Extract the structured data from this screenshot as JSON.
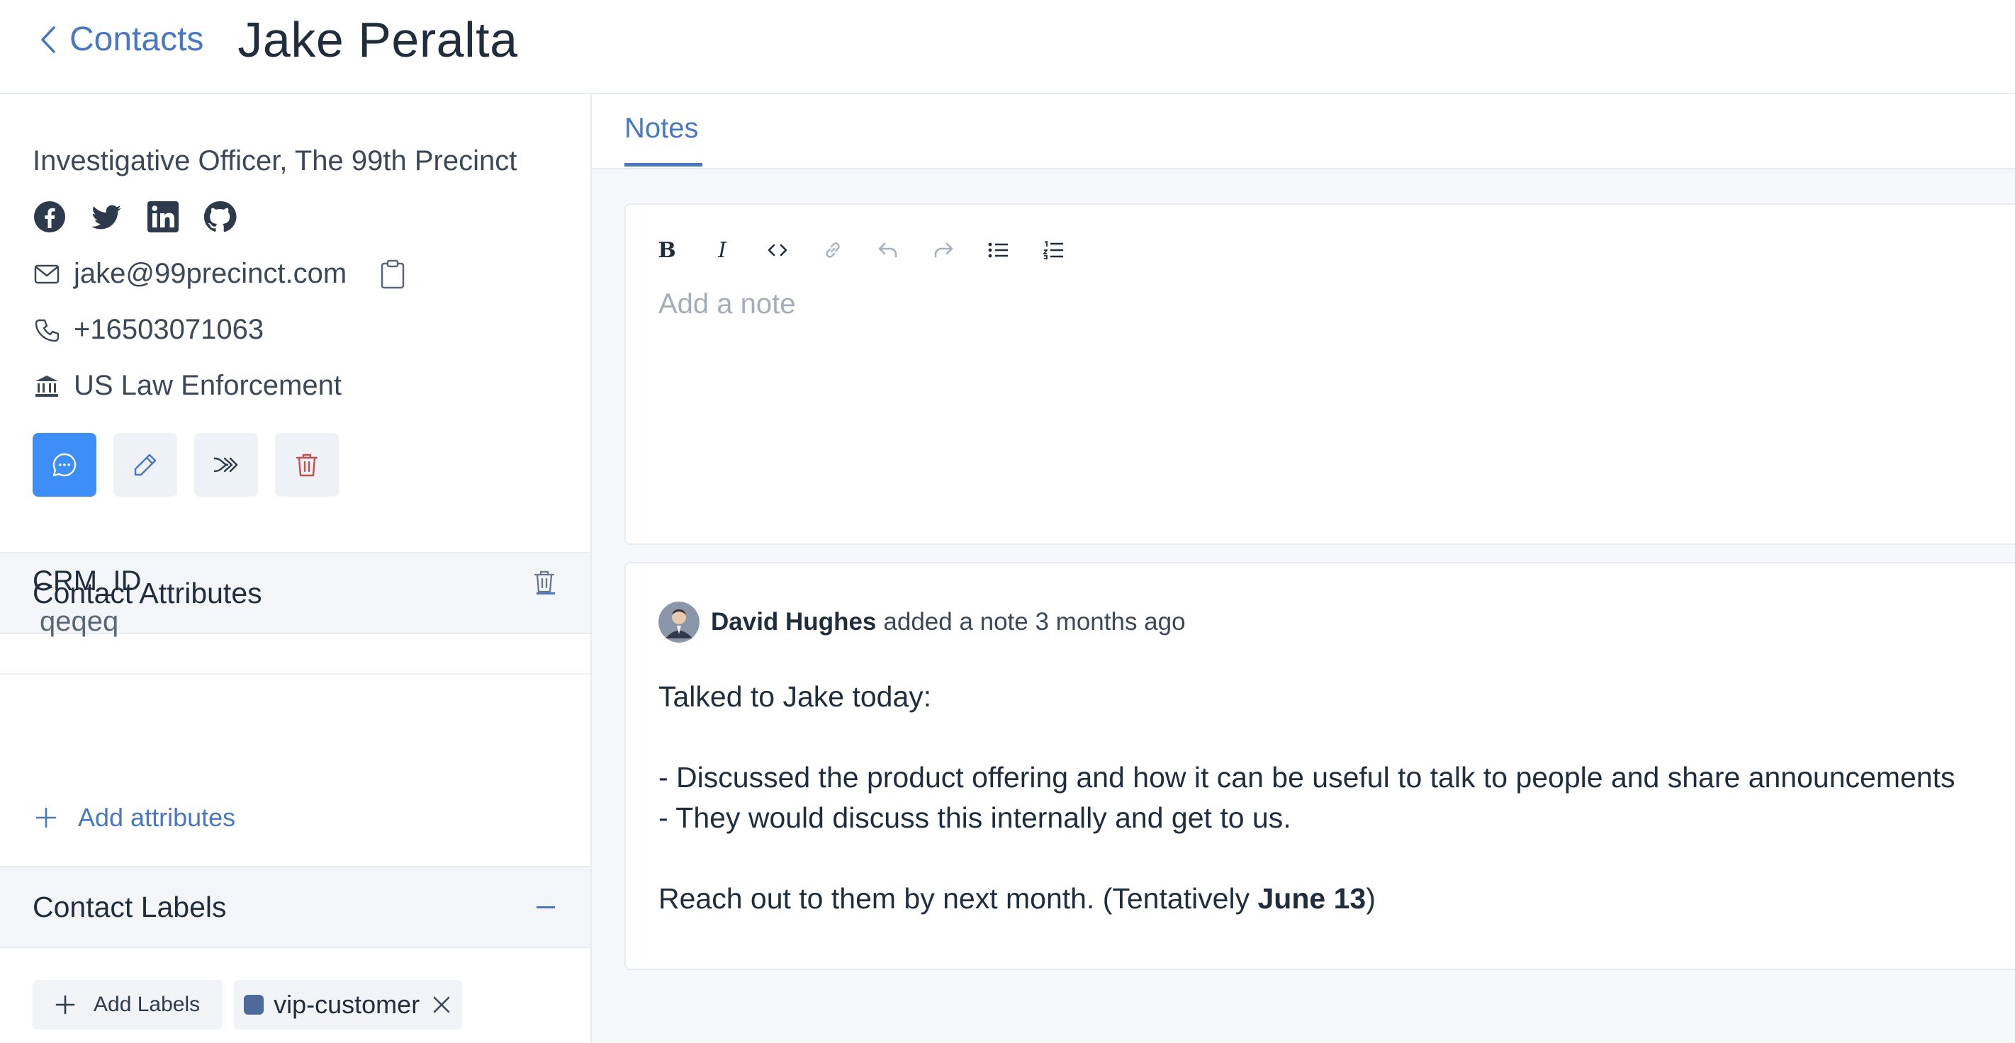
{
  "header": {
    "back_label": "Contacts",
    "title": "Jake Peralta"
  },
  "profile": {
    "job_title": "Investigative Officer, The 99th Precinct",
    "socials": [
      "facebook-icon",
      "twitter-icon",
      "linkedin-icon",
      "github-icon"
    ],
    "email": "jake@99precinct.com",
    "phone": "+16503071063",
    "company": "US Law Enforcement",
    "actions": [
      "chat",
      "edit",
      "merge",
      "delete"
    ]
  },
  "attributes_section": {
    "title": "Contact Attributes",
    "items": [
      {
        "key": "CRM_ID",
        "value": "qeqeq"
      }
    ],
    "add_label": "Add attributes"
  },
  "labels_section": {
    "title": "Contact Labels",
    "add_label": "Add Labels",
    "labels": [
      {
        "name": "vip-customer",
        "color": "#4e6a9a"
      }
    ]
  },
  "tabs": [
    {
      "label": "Notes",
      "active": true
    }
  ],
  "editor": {
    "placeholder": "Add a note",
    "toolbar": [
      "bold",
      "italic",
      "code",
      "link",
      "undo",
      "redo",
      "bullet-list",
      "ordered-list"
    ]
  },
  "note": {
    "author": "David Hughes",
    "action": "added a note 3 months ago",
    "lines": [
      "Talked to Jake today:",
      "",
      "- Discussed the product offering and how it can be useful to talk to people and share announcements",
      "- They would discuss this internally and get to us.",
      "",
      "Reach out to them by next month. (Tentatively "
    ],
    "bold_date": "June 13",
    "closing": ")"
  },
  "colors": {
    "accent": "#4a78c0",
    "primary_button": "#3e8ef7",
    "delete": "#c0504d"
  }
}
